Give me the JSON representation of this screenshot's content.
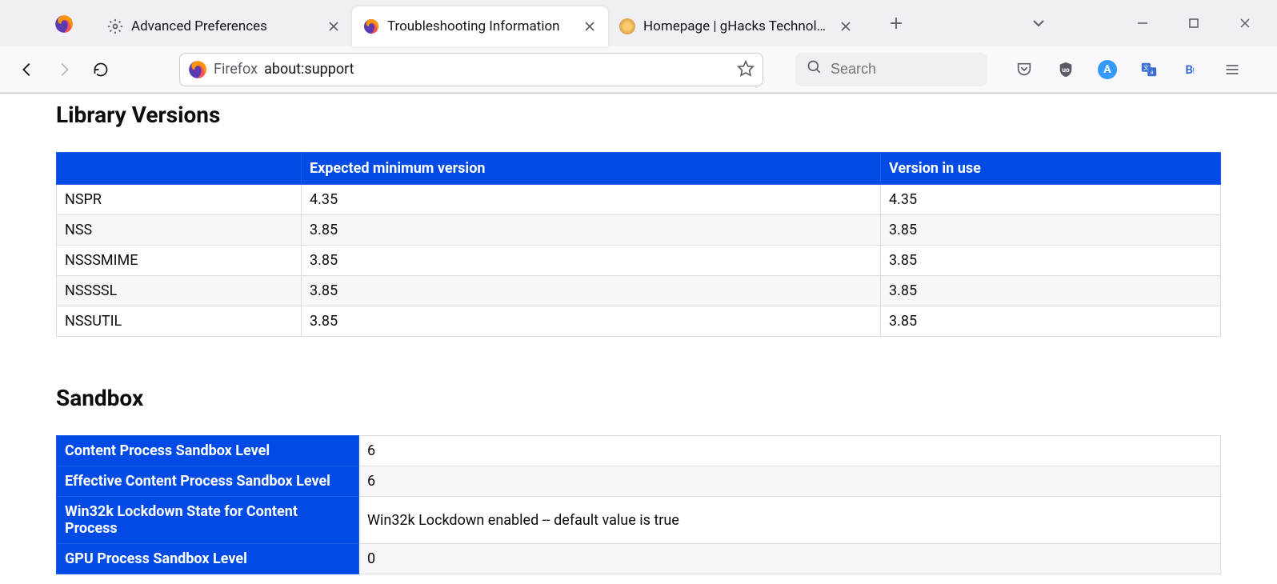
{
  "tabs": [
    {
      "title": "Advanced Preferences"
    },
    {
      "title": "Troubleshooting Information"
    },
    {
      "title": "Homepage | gHacks Technology"
    }
  ],
  "urlbar": {
    "identity": "Firefox",
    "address": "about:support"
  },
  "searchbar": {
    "placeholder": "Search"
  },
  "sections": {
    "library": {
      "title": "Library Versions",
      "headers": [
        "",
        "Expected minimum version",
        "Version in use"
      ],
      "rows": [
        {
          "name": "NSPR",
          "expected": "4.35",
          "inuse": "4.35"
        },
        {
          "name": "NSS",
          "expected": "3.85",
          "inuse": "3.85"
        },
        {
          "name": "NSSSMIME",
          "expected": "3.85",
          "inuse": "3.85"
        },
        {
          "name": "NSSSSL",
          "expected": "3.85",
          "inuse": "3.85"
        },
        {
          "name": "NSSUTIL",
          "expected": "3.85",
          "inuse": "3.85"
        }
      ]
    },
    "sandbox": {
      "title": "Sandbox",
      "rows": [
        {
          "key": "Content Process Sandbox Level",
          "value": "6"
        },
        {
          "key": "Effective Content Process Sandbox Level",
          "value": "6"
        },
        {
          "key": "Win32k Lockdown State for Content Process",
          "value": "Win32k Lockdown enabled -- default value is true"
        },
        {
          "key": "GPU Process Sandbox Level",
          "value": "0"
        }
      ]
    }
  }
}
